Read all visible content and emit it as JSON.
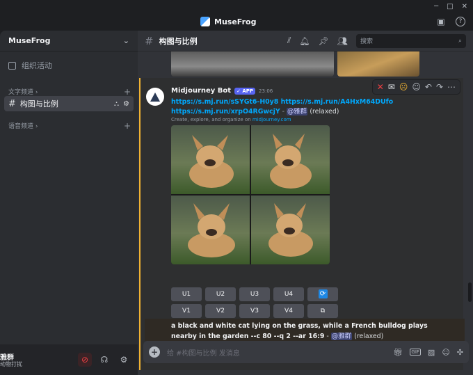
{
  "app": {
    "title": "MuseFrog"
  },
  "sidebar": {
    "server_name": "MuseFrog",
    "events_label": "组织活动",
    "text_category": "文字频道",
    "voice_category": "语音频道",
    "active_channel": "构图与比例"
  },
  "user": {
    "name": "雅群",
    "status": "动物打扰"
  },
  "header": {
    "channel_name": "构图与比例",
    "search_placeholder": "搜索"
  },
  "message": {
    "author": "Midjourney Bot",
    "badge": "✓ APP",
    "time": "23:06",
    "link1": "https://s.mj.run/sSYGt6-H0y8",
    "link2": "https://s.mj.run/A4HxM64DUfo",
    "link3": "https://s.mj.run/xrpO4RGwcjY",
    "sep": " - ",
    "mention": "@雅群",
    "mode": "(relaxed)",
    "embed_prefix": "Create, explore, and organize on ",
    "embed_link": "midjourney.com",
    "buttons": [
      "U1",
      "U2",
      "U3",
      "U4",
      "V1",
      "V2",
      "V3",
      "V4"
    ]
  },
  "next_message": {
    "prompt": "a black and white cat lying on the grass, while a French bulldog plays nearby in the garden --c 80 --q 2 --ar 16:9",
    "sep": " - ",
    "mention": "@雅群",
    "mode": "(relaxed)"
  },
  "composer": {
    "placeholder": "给 #构图与比例 发消息"
  },
  "colors": {
    "accent": "#5865f2",
    "link": "#00a8fc",
    "highlight": "#f0b232",
    "background": "#313338"
  }
}
